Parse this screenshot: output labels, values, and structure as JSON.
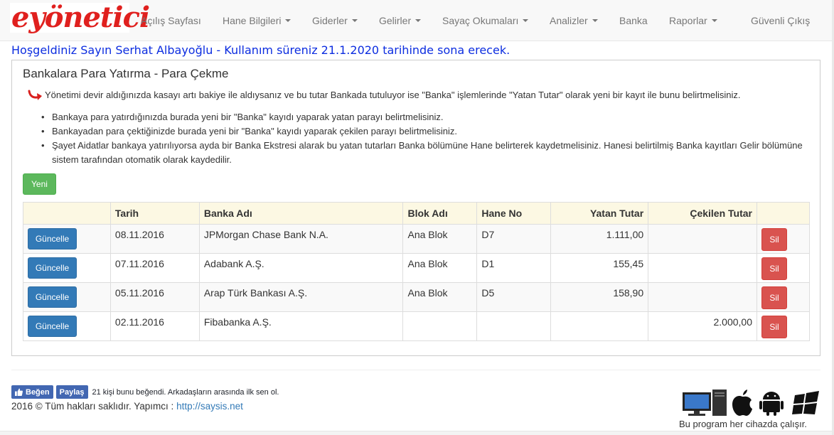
{
  "brand": {
    "logo_text": "eyönetici"
  },
  "nav": [
    {
      "label": "Açılış Sayfası",
      "dropdown": false
    },
    {
      "label": "Hane Bilgileri",
      "dropdown": true
    },
    {
      "label": "Giderler",
      "dropdown": true
    },
    {
      "label": "Gelirler",
      "dropdown": true
    },
    {
      "label": "Sayaç Okumaları",
      "dropdown": true
    },
    {
      "label": "Analizler",
      "dropdown": true
    },
    {
      "label": "Banka",
      "dropdown": false
    },
    {
      "label": "Raporlar",
      "dropdown": true
    },
    {
      "label": "Güvenli Çıkış",
      "dropdown": false
    }
  ],
  "welcome": "Hoşgeldiniz Sayın Serhat Albayoğlu - Kullanım süreniz 21.1.2020 tarihinde sona erecek.",
  "panel": {
    "title": "Bankalara Para Yatırma - Para Çekme",
    "info": "Yönetimi devir aldığınızda kasayı artı bakiye ile aldıysanız ve bu tutar Bankada tutuluyor ise \"Banka\" işlemlerinde \"Yatan Tutar\" olarak yeni bir kayıt ile bunu belirtmelisiniz.",
    "bullets": [
      "Bankaya para yatırdığınızda burada yeni bir \"Banka\" kayıdı yaparak yatan parayı belirtmelisiniz.",
      "Bankayadan para çektiğinizde burada yeni bir \"Banka\" kayıdı yaparak çekilen parayı belirtmelisiniz.",
      "Şayet Aidatlar bankaya yatırılıyorsa ayda bir Banka Ekstresi alarak bu yatan tutarları Banka bölümüne Hane belirterek kaydetmelisiniz. Hanesi belirtilmiş Banka kayıtları Gelir bölümüne sistem tarafından otomatik olarak kaydedilir."
    ],
    "new_button": "Yeni"
  },
  "table": {
    "headers": [
      "",
      "Tarih",
      "Banka Adı",
      "Blok Adı",
      "Hane No",
      "Yatan Tutar",
      "Çekilen Tutar",
      ""
    ],
    "update_label": "Güncelle",
    "delete_label": "Sil",
    "rows": [
      {
        "tarih": "08.11.2016",
        "banka": "JPMorgan Chase Bank N.A.",
        "blok": "Ana Blok",
        "hane": "D7",
        "yatan": "1.111,00",
        "cekilen": ""
      },
      {
        "tarih": "07.11.2016",
        "banka": "Adabank A.Ş.",
        "blok": "Ana Blok",
        "hane": "D1",
        "yatan": "155,45",
        "cekilen": ""
      },
      {
        "tarih": "05.11.2016",
        "banka": "Arap Türk Bankası A.Ş.",
        "blok": "Ana Blok",
        "hane": "D5",
        "yatan": "158,90",
        "cekilen": ""
      },
      {
        "tarih": "02.11.2016",
        "banka": "Fibabanka A.Ş.",
        "blok": "",
        "hane": "",
        "yatan": "",
        "cekilen": "2.000,00"
      }
    ]
  },
  "footer": {
    "like_label": "Beğen",
    "share_label": "Paylaş",
    "like_text": "21 kişi bunu beğendi. Arkadaşların arasında ilk sen ol.",
    "copyright": "2016 © Tüm hakları saklıdır. Yapımcı :",
    "maker_link": "http://saysis.net",
    "devices_text": "Bu program her cihazda çalışır.",
    "device_icons": [
      "desktop-icon",
      "apple-icon",
      "android-icon",
      "windows-icon"
    ]
  },
  "colors": {
    "brand": "#e0201e",
    "welcome": "#0c2de0",
    "primary": "#337ab7",
    "success": "#5cb85c",
    "danger": "#d9534f",
    "table_head": "#fcf8e3"
  }
}
